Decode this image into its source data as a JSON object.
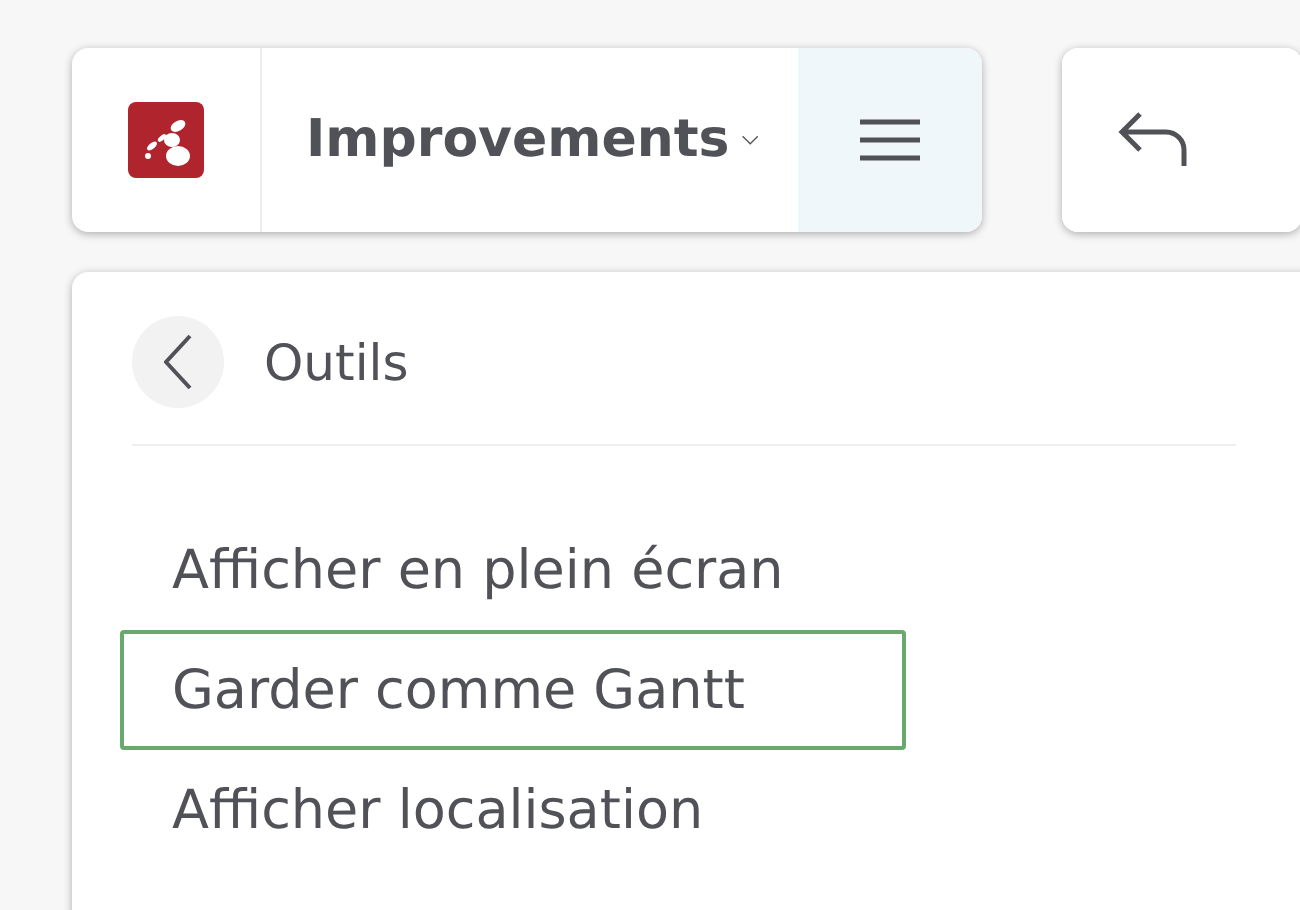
{
  "toolbar": {
    "title": "Improvements",
    "menu_active": true
  },
  "menu": {
    "title": "Outils",
    "items": [
      {
        "label": "Afficher en plein écran",
        "focused": false
      },
      {
        "label": "Garder comme Gantt",
        "focused": true
      },
      {
        "label": "Afficher localisation",
        "focused": false
      }
    ]
  }
}
